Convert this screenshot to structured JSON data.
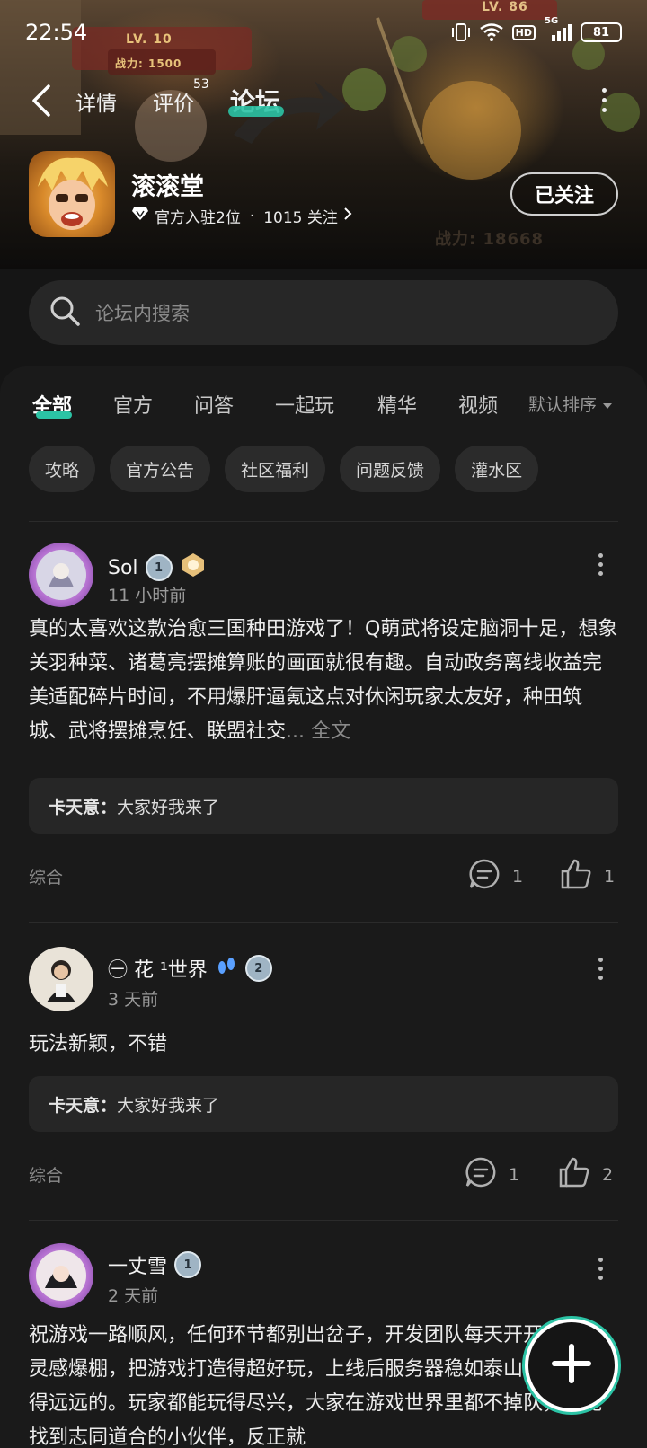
{
  "status_bar": {
    "time": "22:54",
    "network": "5G",
    "hd": "HD",
    "battery": "81"
  },
  "hero": {
    "badge_left": "LV. 10",
    "badge_power": "战力: 1500",
    "badge_right": "LV. 86",
    "faint_power": "战力: 18668"
  },
  "nav": {
    "tabs": [
      {
        "label": "详情"
      },
      {
        "label": "评价"
      },
      {
        "label": "论坛"
      }
    ],
    "review_count": "53"
  },
  "app": {
    "name": "滚滚堂",
    "meta_official": "官方入驻2位",
    "meta_sep": "·",
    "meta_follows": "1015 关注",
    "follow_label": "已关注"
  },
  "search": {
    "placeholder": "论坛内搜索"
  },
  "categories": [
    {
      "label": "全部"
    },
    {
      "label": "官方"
    },
    {
      "label": "问答"
    },
    {
      "label": "一起玩"
    },
    {
      "label": "精华"
    },
    {
      "label": "视频"
    }
  ],
  "sort_label": "默认排序",
  "chips": [
    {
      "label": "攻略"
    },
    {
      "label": "官方公告"
    },
    {
      "label": "社区福利"
    },
    {
      "label": "问题反馈"
    },
    {
      "label": "灌水区"
    }
  ],
  "posts": [
    {
      "user": "Sol",
      "level": "1",
      "time": "11 小时前",
      "body": "真的太喜欢这款治愈三国种田游戏了！Q萌武将设定脑洞十足，想象关羽种菜、诸葛亮摆摊算账的画面就很有趣。自动政务离线收益完美适配碎片时间，不用爆肝逼氪这点对休闲玩家太友好，种田筑城、武将摆摊烹饪、联盟社交",
      "more": "... 全文",
      "reply_user": "卡天意：",
      "reply_text": "大家好我来了",
      "tag": "综合",
      "comments": "1",
      "likes": "1"
    },
    {
      "user": "㊀ 花 ¹世界",
      "level": "2",
      "time": "3 天前",
      "body": "玩法新颖，不错",
      "reply_user": "卡天意：",
      "reply_text": "大家好我来了",
      "tag": "综合",
      "comments": "1",
      "likes": "2"
    },
    {
      "user": "一丈雪",
      "level": "1",
      "time": "2 天前",
      "body": "祝游戏一路顺风，任何环节都别出岔子，开发团队每天开开心心，灵感爆棚，把游戏打造得超好玩，上线后服务器稳如泰山， BUG躲得远远的。玩家都能玩得尽兴，大家在游戏世界里都不掉队，都能找到志同道合的小伙伴，反正就"
    }
  ]
}
